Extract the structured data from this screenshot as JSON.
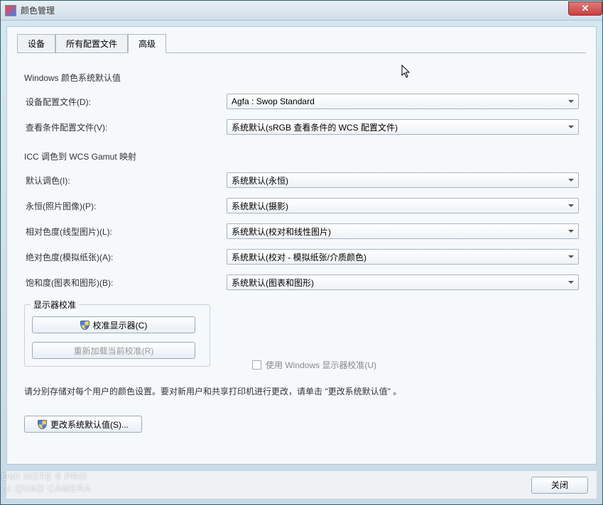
{
  "window": {
    "title": "颜色管理"
  },
  "tabs": {
    "device": "设备",
    "profiles": "所有配置文件",
    "advanced": "高级"
  },
  "section1": {
    "title": "Windows 颜色系统默认值",
    "deviceProfile": {
      "label": "设备配置文件(D):",
      "value": "Agfa : Swop Standard"
    },
    "viewingProfile": {
      "label": "查看条件配置文件(V):",
      "value": "系统默认(sRGB 查看条件的 WCS 配置文件)"
    }
  },
  "section2": {
    "title": "ICC 调色到 WCS Gamut 映射",
    "defaultIntent": {
      "label": "默认调色(I):",
      "value": "系统默认(永恒)"
    },
    "perceptual": {
      "label": "永恒(照片图像)(P):",
      "value": "系统默认(摄影)"
    },
    "relative": {
      "label": "相对色度(线型图片)(L):",
      "value": "系统默认(校对和线性图片)"
    },
    "absolute": {
      "label": "绝对色度(模拟纸张)(A):",
      "value": "系统默认(校对 - 模拟纸张/介质颜色)"
    },
    "saturation": {
      "label": "饱和度(图表和图形)(B):",
      "value": "系统默认(图表和图形)"
    }
  },
  "display": {
    "legend": "显示器校准",
    "calibrate": "校准显示器(C)",
    "reload": "重新加载当前校准(R)",
    "useWindows": "使用 Windows 显示器校准(U)"
  },
  "footer": {
    "note": "请分别存储对每个用户的颜色设置。要对新用户和共享打印机进行更改，请单击 \"更改系统默认值\" 。",
    "changeDefaults": "更改系统默认值(S)...",
    "close": "关闭"
  },
  "watermark": {
    "line1": "DMI NOTE 8 PRO",
    "line2": "AI QUAD CAMERA"
  }
}
